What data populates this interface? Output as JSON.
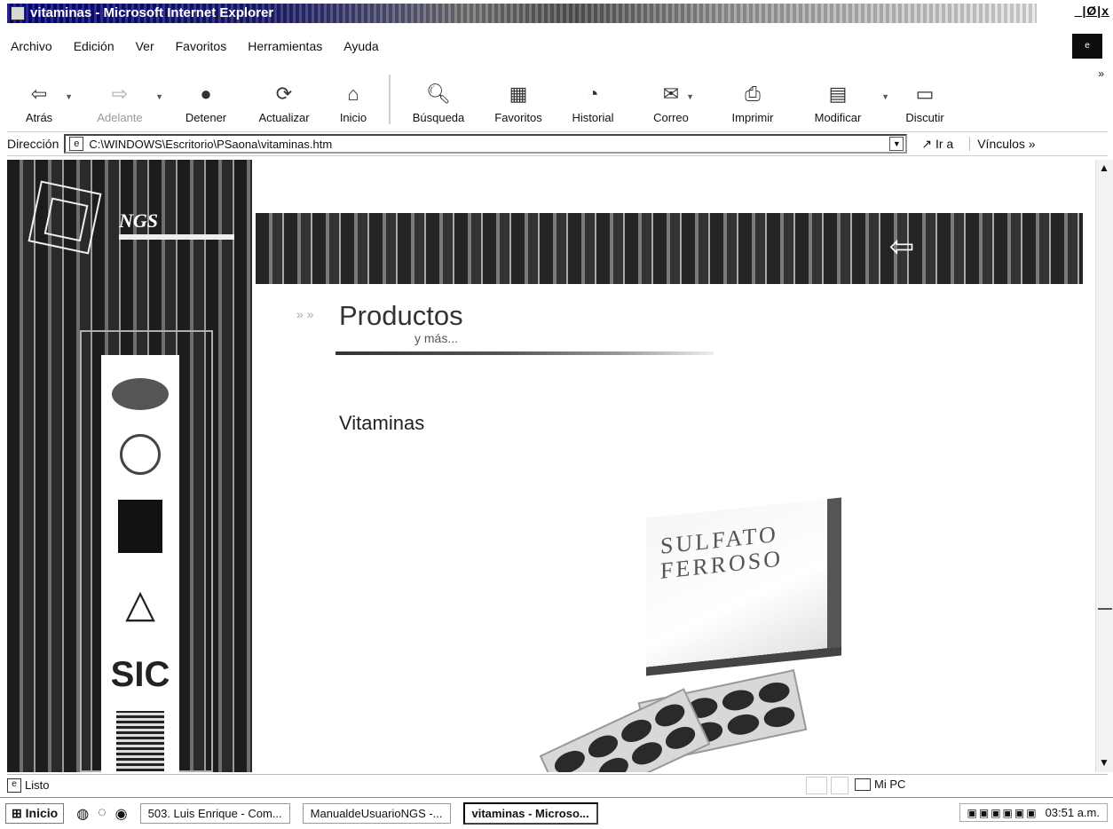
{
  "window": {
    "title": "vitaminas - Microsoft Internet Explorer",
    "controls": "_|Ø|x"
  },
  "menu": [
    "Archivo",
    "Edición",
    "Ver",
    "Favoritos",
    "Herramientas",
    "Ayuda"
  ],
  "toolbar": {
    "buttons": [
      {
        "label": "Atrás",
        "icon": "back-arrow-icon"
      },
      {
        "label": "Adelante",
        "icon": "forward-arrow-icon"
      },
      {
        "label": "Detener",
        "icon": "stop-icon"
      },
      {
        "label": "Actualizar",
        "icon": "refresh-icon"
      },
      {
        "label": "Inicio",
        "icon": "home-icon"
      },
      {
        "label": "Búsqueda",
        "icon": "search-icon"
      },
      {
        "label": "Favoritos",
        "icon": "favorites-icon"
      },
      {
        "label": "Historial",
        "icon": "history-icon"
      },
      {
        "label": "Correo",
        "icon": "mail-icon"
      },
      {
        "label": "Imprimir",
        "icon": "print-icon"
      },
      {
        "label": "Modificar",
        "icon": "edit-icon"
      },
      {
        "label": "Discutir",
        "icon": "discuss-icon"
      }
    ],
    "more": "»"
  },
  "address": {
    "label": "Dirección",
    "value": "C:\\WINDOWS\\Escritorio\\PSaona\\vitaminas.htm",
    "go": "Ir a",
    "links": "Vínculos »"
  },
  "page": {
    "logo_text": "NGS",
    "section_title": "Productos",
    "section_subtitle": "y más...",
    "product_heading": "Vitaminas",
    "box_label_line1": "SULFATO",
    "box_label_line2": "FERROSO",
    "cert_sic": "SIC",
    "nav_icon": "back-arrow-icon"
  },
  "status": {
    "text": "Listo",
    "zone": "Mi PC"
  },
  "taskbar": {
    "start": "Inicio",
    "tasks": [
      "503. Luis Enrique - Com...",
      "ManualdeUsuarioNGS -...",
      "vitaminas - Microso..."
    ],
    "clock": "03:51 a.m."
  }
}
